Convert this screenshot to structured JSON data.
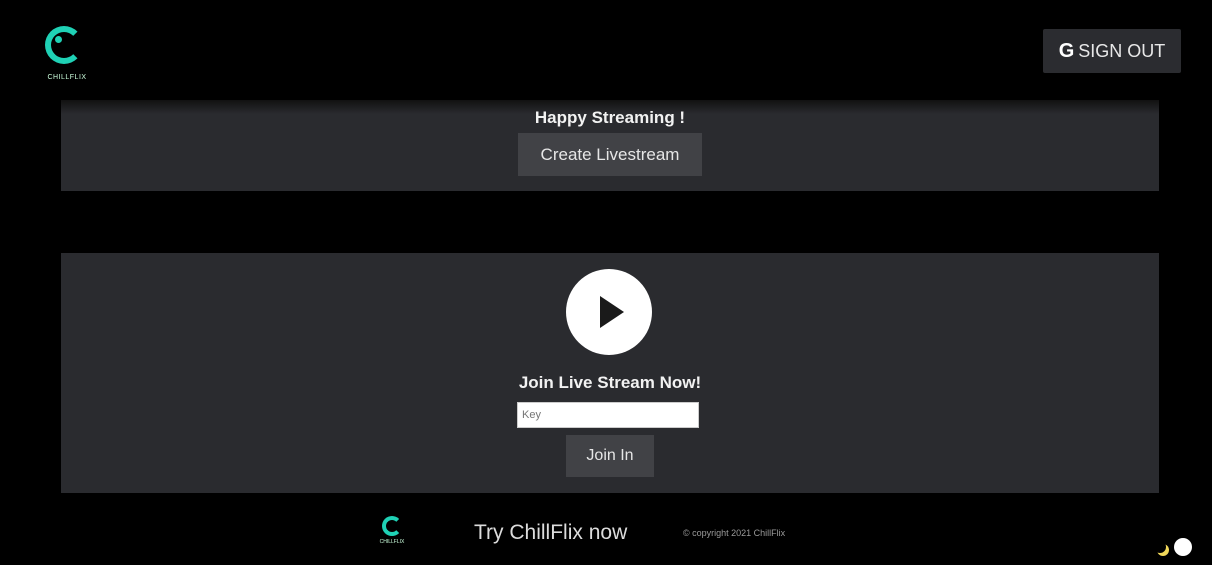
{
  "navbar": {
    "logo_text": "CHILLFLIX",
    "signout": {
      "icon": "G",
      "label": "SIGN OUT"
    }
  },
  "stream_panel": {
    "message": "Happy Streaming !",
    "create_button": "Create Livestream"
  },
  "join_panel": {
    "play_icon": "play-icon",
    "title": "Join Live Stream Now!",
    "key_placeholder": "Key",
    "join_button": "Join In"
  },
  "footer": {
    "logo_text": "CHILLFLIX",
    "tagline": "Try ChillFlix now",
    "copyright": "© copyright 2021 ChillFlix"
  },
  "colors": {
    "accent": "#1fd1b5",
    "panel": "#2a2b2f",
    "button": "#414246"
  },
  "theme_toggle": {
    "icon": "moon-icon"
  }
}
